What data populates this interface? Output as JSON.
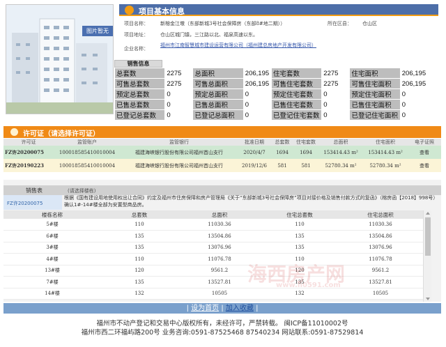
{
  "photo": {
    "label": "图片暂无"
  },
  "project_info": {
    "title": "项目基本信息",
    "fields": [
      {
        "key": "项目名称：",
        "value": "新榕金江墩（东部新城3号社会保障房（东部8#地二期））"
      },
      {
        "key": "项目地址：",
        "value": "仓山区城门镇，三江路以北、福泉高速以东。"
      },
      {
        "key": "企业名称：",
        "value": "福州市江南智慧城市建设运营有限公司（福州建总房地产开发有限公司）"
      }
    ],
    "district_key": "所在区县：",
    "district_value": "仓山区"
  },
  "sales_info": {
    "title": "销售信息",
    "rows": [
      [
        "总套数",
        "2275",
        "总面积",
        "206,195",
        "住宅套数",
        "2275",
        "住宅面积",
        "206,195"
      ],
      [
        "可售总套数",
        "2275",
        "可售总面积",
        "206,195",
        "可售住宅套数",
        "2275",
        "可售住宅面积",
        "206,195"
      ],
      [
        "预定总套数",
        "0",
        "预定总面积",
        "0",
        "预定住宅套数",
        "0",
        "预定住宅面积",
        "0"
      ],
      [
        "已售总套数",
        "0",
        "已售总面积",
        "0",
        "已售住宅套数",
        "0",
        "已售住宅面积",
        "0"
      ],
      [
        "已登记总套数",
        "0",
        "已登记总面积",
        "0",
        "已登记住宅套数",
        "0",
        "已登记住宅面积",
        "0"
      ]
    ]
  },
  "permits": {
    "title": "许可证（请选择许可证）",
    "headers": [
      "许可证",
      "监管账户",
      "监管银行",
      "批准日期",
      "总套数",
      "住宅套数",
      "总面积",
      "住宅面积",
      "电子证照"
    ],
    "rows": [
      [
        "FZ许20200075",
        "100018585410010004",
        "福建海峡银行股份有限公司福州首山支行",
        "2020/4/7",
        "1694",
        "1694",
        "153414.43 m²",
        "153414.43 m²",
        "查看"
      ],
      [
        "FZ许20190223",
        "100018585410010004",
        "福建海峡银行股份有限公司福州首山支行",
        "2019/12/6",
        "581",
        "581",
        "52780.34 m²",
        "52780.34 m²",
        "查看"
      ]
    ]
  },
  "sales_table": {
    "title": "销售表",
    "hint": "(请选择楼栋)",
    "permit_ref": "FZ许20200075",
    "notice": "根据《国有建设用地使用权出让合同》约定及福州市住房保障和房产管理局《关于“东部新城3号社会保障房”项目对接价格及销售付款方式的复函》（榕房函【2018】998号）确认1#-14#楼全部为安置型商品房。"
  },
  "buildings": {
    "headers": [
      "楼栋名称",
      "总套数",
      "总面积",
      "住宅总套数",
      "住宅总面积"
    ],
    "rows": [
      [
        "5#楼",
        "110",
        "11030.36",
        "110",
        "11030.36"
      ],
      [
        "6#楼",
        "135",
        "13504.86",
        "135",
        "13504.86"
      ],
      [
        "3#楼",
        "135",
        "13076.96",
        "135",
        "13076.96"
      ],
      [
        "4#楼",
        "110",
        "11076.78",
        "110",
        "11076.78"
      ],
      [
        "13#楼",
        "120",
        "9561.2",
        "120",
        "9561.2"
      ],
      [
        "7#楼",
        "135",
        "13527.81",
        "135",
        "13527.81"
      ],
      [
        "14#楼",
        "132",
        "10505",
        "132",
        "10505"
      ]
    ]
  },
  "watermark": {
    "main": "海西房产网",
    "sub": "www.h0591.com"
  },
  "footer": {
    "link_home": "设为首页",
    "separator": "|",
    "link_fav": "加入收藏",
    "line1": "福州市不动产登记和交易中心版权所有，未经许可，严禁转载。 闽ICP备11010002号",
    "line2": "福州市西二环福屿路200号 业务咨询:0591-87525468 87540234   网站联系:0591-87529814"
  },
  "colors": {
    "info_header": "#4d6ea8",
    "permit_header": "#f08a16",
    "accent": "#f39c12"
  }
}
